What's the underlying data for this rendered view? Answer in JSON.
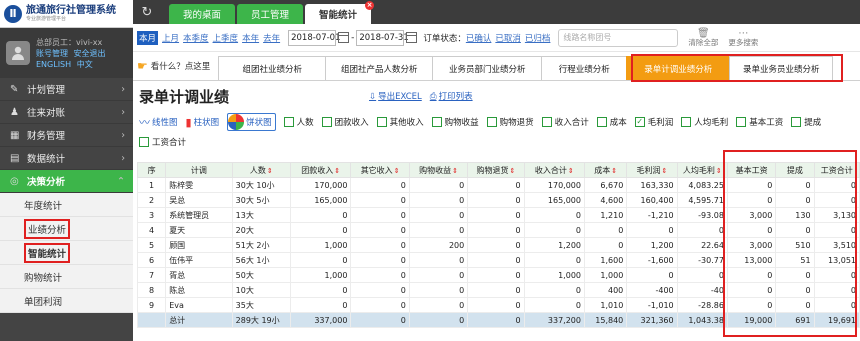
{
  "app": {
    "logo_letter": "Ⅱ",
    "logo_title": "旅通旅行社管理系统",
    "logo_subtitle": "专业旅游管理平台"
  },
  "user": {
    "label_prefix": "总部员工：",
    "name": "vivi-xx",
    "links": [
      "账号管理",
      "安全退出",
      "ENGLISH",
      "中文"
    ]
  },
  "sidebar": {
    "items": [
      {
        "label": "计划管理",
        "icon": "edit-icon",
        "glyph": "✎"
      },
      {
        "label": "往来对账",
        "icon": "users-icon",
        "glyph": "👥"
      },
      {
        "label": "财务管理",
        "icon": "finance-icon",
        "glyph": "▦"
      },
      {
        "label": "数据统计",
        "icon": "stats-icon",
        "glyph": "▤"
      },
      {
        "label": "决策分析",
        "icon": "target-icon",
        "glyph": "◎"
      }
    ],
    "sub_items": [
      "年度统计",
      "业绩分析",
      "智能统计",
      "购物统计",
      "单团利润"
    ]
  },
  "tabs": [
    "我的桌面",
    "员工管理",
    "智能统计"
  ],
  "filter": {
    "periods": [
      "本月",
      "上月",
      "本季度",
      "上季度",
      "本年",
      "去年"
    ],
    "date_from": "2018-07-01",
    "date_sep": "-",
    "date_to": "2018-07-31",
    "status_label": "订单状态：",
    "statuses": [
      "已确认",
      "已取消",
      "已归档"
    ],
    "search_placeholder": "线路名称团号",
    "clear_label": "清除全部",
    "more_label": "更多搜索"
  },
  "report_tabs": {
    "help": "看什么？点这里",
    "items": [
      "组团社业绩分析",
      "组团社产品人数分析",
      "业务员部门业绩分析",
      "行程业绩分析",
      "录单计调业绩分析",
      "录单业务员业绩分析"
    ]
  },
  "page": {
    "title": "录单计调业绩",
    "export_excel": "导出EXCEL",
    "print_list": "打印列表"
  },
  "chart_buttons": [
    "线性图",
    "柱状图",
    "饼状图"
  ],
  "columns_toggle": [
    {
      "label": "人数",
      "checked": false
    },
    {
      "label": "团款收入",
      "checked": false
    },
    {
      "label": "其他收入",
      "checked": false
    },
    {
      "label": "购物收益",
      "checked": false
    },
    {
      "label": "购物退货",
      "checked": false
    },
    {
      "label": "收入合计",
      "checked": false
    },
    {
      "label": "成本",
      "checked": false
    },
    {
      "label": "毛利润",
      "checked": true
    },
    {
      "label": "人均毛利",
      "checked": false
    },
    {
      "label": "基本工资",
      "checked": false
    },
    {
      "label": "提成",
      "checked": false
    },
    {
      "label": "工资合计",
      "checked": false
    }
  ],
  "table": {
    "headers": [
      "序",
      "计调",
      "人数",
      "团款收入",
      "其它收入",
      "购物收益",
      "购物退货",
      "收入合计",
      "成本",
      "毛利润",
      "人均毛利",
      "基本工资",
      "提成",
      "工资合计"
    ],
    "rows": [
      [
        "1",
        "陈梓雯",
        "30大 10小",
        "170,000",
        "0",
        "0",
        "0",
        "170,000",
        "6,670",
        "163,330",
        "4,083.25",
        "0",
        "0",
        "0"
      ],
      [
        "2",
        "吴总",
        "30大 5小",
        "165,000",
        "0",
        "0",
        "0",
        "165,000",
        "4,600",
        "160,400",
        "4,595.71",
        "0",
        "0",
        "0"
      ],
      [
        "3",
        "系统管理员",
        "13大",
        "0",
        "0",
        "0",
        "0",
        "0",
        "1,210",
        "-1,210",
        "-93.08",
        "3,000",
        "130",
        "3,130"
      ],
      [
        "4",
        "夏天",
        "20大",
        "0",
        "0",
        "0",
        "0",
        "0",
        "0",
        "0",
        "0",
        "0",
        "0",
        "0"
      ],
      [
        "5",
        "顾国",
        "51大 2小",
        "1,000",
        "0",
        "200",
        "0",
        "1,200",
        "0",
        "1,200",
        "22.64",
        "3,000",
        "510",
        "3,510"
      ],
      [
        "6",
        "伍伟平",
        "56大 1小",
        "0",
        "0",
        "0",
        "0",
        "0",
        "1,600",
        "-1,600",
        "-30.77",
        "13,000",
        "51",
        "13,051"
      ],
      [
        "7",
        "胥总",
        "50大",
        "1,000",
        "0",
        "0",
        "0",
        "1,000",
        "1,000",
        "0",
        "0",
        "0",
        "0",
        "0"
      ],
      [
        "8",
        "陈总",
        "10大",
        "0",
        "0",
        "0",
        "0",
        "0",
        "400",
        "-400",
        "-40",
        "0",
        "0",
        "0"
      ],
      [
        "9",
        "Eva",
        "35大",
        "0",
        "0",
        "0",
        "0",
        "0",
        "1,010",
        "-1,010",
        "-28.86",
        "0",
        "0",
        "0"
      ]
    ],
    "total": [
      "",
      "总计",
      "289大 19小",
      "337,000",
      "0",
      "0",
      "0",
      "337,200",
      "15,840",
      "321,360",
      "1,043.38",
      "19,000",
      "691",
      "19,691"
    ]
  },
  "colors": {
    "sidebar_bg": "#444444",
    "accent_green": "#3db54a",
    "active_orange": "#f39c12",
    "highlight_red": "#e02020",
    "link_blue": "#2a62c0"
  }
}
